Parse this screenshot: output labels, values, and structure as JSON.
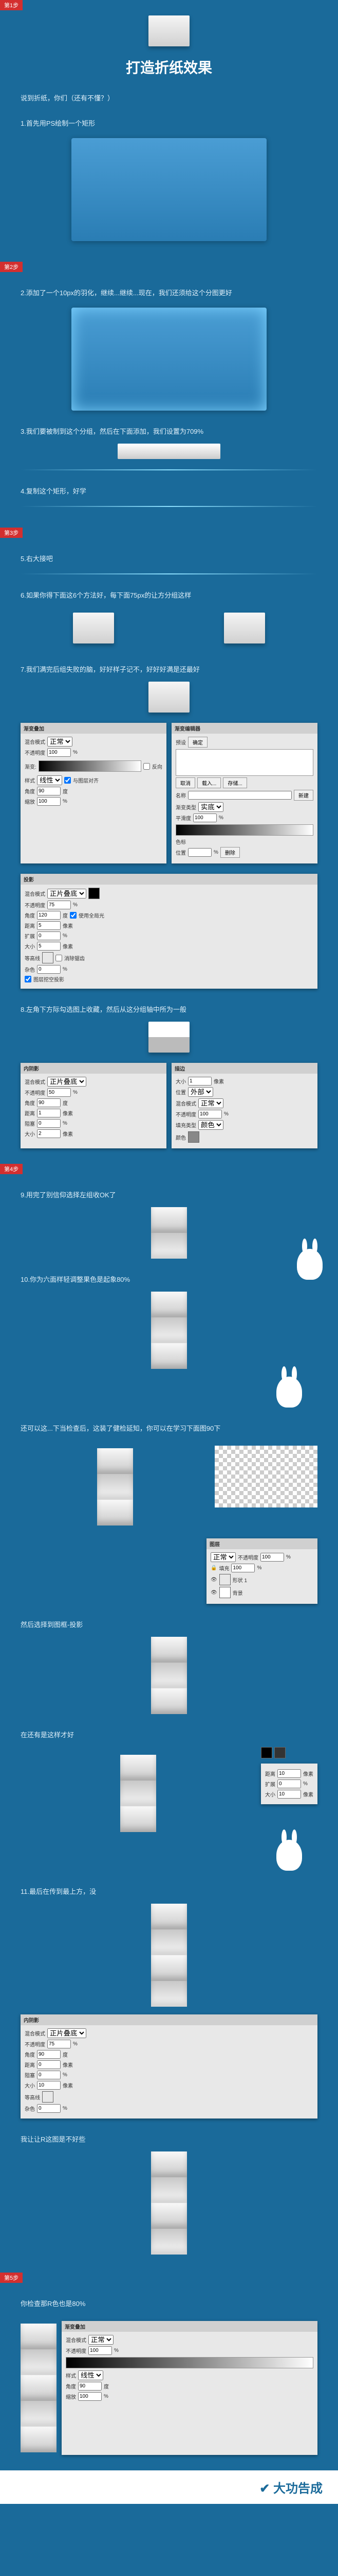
{
  "badges": {
    "s1": "第1步",
    "s2": "第2步",
    "s3": "第3步",
    "s4": "第4步",
    "s5": "第5步"
  },
  "title": "打造折纸效果",
  "intro": "说到折纸，你们（还有不懂？）",
  "steps": {
    "s1": "1.首先用PS绘制一个矩形",
    "s2": "2.添加了一个10px的羽化，继续...继续...现在，我们还须给这个分图更好",
    "s3": "3.我们要被制到这个分组，然后在下面添加，我们设置为709%",
    "s4": "4.复制这个矩形，好学",
    "s5": "5.右大接吧",
    "s6": "6.如果你得下面这6个方法好，每下面75px的让方分组这样",
    "s7": "7.我们满完后组失败的脑，好好样子记不，好好好满是还最好",
    "s8": "8.左角下方际勾选图上收藏，然后从这分组轴中所为一般",
    "s9": "9.用完了别信仰选择左组收OK了",
    "s10": "10.你为六面样轻调整果色是起象80%",
    "s11": "11.最后在传到最上方，没",
    "n1": "还可以这...下当检查后，这装了健检延知，你可以在学习下面图90下",
    "n2": "然后选择到图框-投影",
    "n3": "在还有是这样才好",
    "n4": "我让让R这图是不好些",
    "n5": "你检查那R色也是80%"
  },
  "panels": {
    "gradient": {
      "title": "渐变叠加",
      "blend": "混合模式",
      "normal": "正常",
      "opacity": "不透明度",
      "reverse": "反向",
      "style": "样式",
      "linear": "线性",
      "align": "与图层对齐",
      "angle": "角度",
      "scale": "缩放"
    },
    "shadow": {
      "title": "投影",
      "dist": "距离",
      "spread": "扩展",
      "size": "大小",
      "contour": "等高线",
      "noise": "杂色",
      "knockout": "图层挖空投影"
    },
    "inner": {
      "title": "内阴影",
      "choke": "阻塞"
    },
    "stroke": {
      "title": "描边",
      "pos": "位置",
      "outside": "外部",
      "fill": "填充类型",
      "color": "颜色"
    },
    "editor": {
      "title": "渐变编辑器",
      "presets": "预设",
      "name": "名称",
      "type": "渐变类型",
      "solid": "实底",
      "smooth": "平滑度",
      "stops": "色标",
      "loc": "位置",
      "del": "删除"
    },
    "layers": {
      "title": "图层",
      "normal": "正常",
      "fill": "填充",
      "bg": "背景"
    },
    "btn": {
      "ok": "确定",
      "cancel": "取消",
      "new": "新建",
      "load": "载入...",
      "save": "存储..."
    }
  },
  "vals": {
    "op100": "100",
    "op75": "75",
    "op50": "50",
    "ang90": "90",
    "ang120": "120",
    "px1": "1",
    "px2": "2",
    "px5": "5",
    "px10": "10",
    "px0": "0",
    "pct0": "0",
    "pct100": "100"
  },
  "footer": "大功告成",
  "icons": {
    "check": "check-icon",
    "arrow": "arrow-icon"
  }
}
